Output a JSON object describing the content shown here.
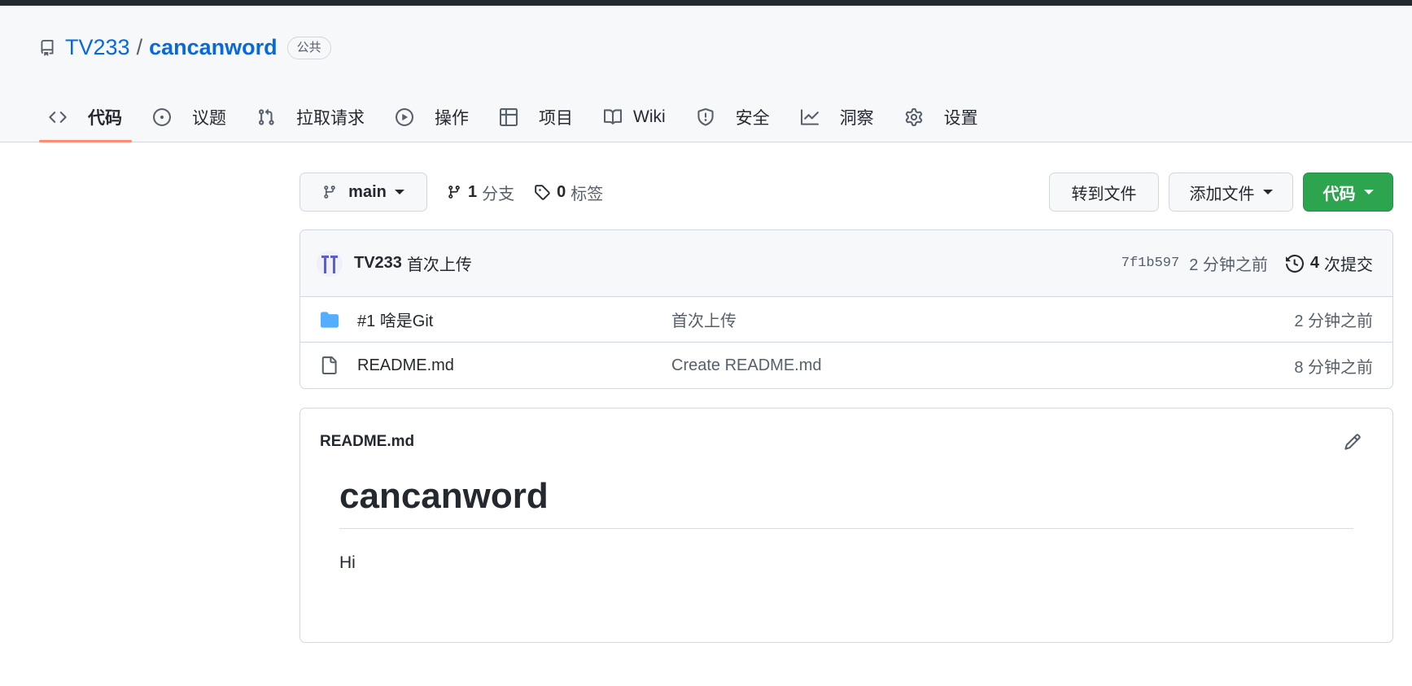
{
  "repo": {
    "owner": "TV233",
    "separator": "/",
    "name": "cancanword",
    "visibility": "公共"
  },
  "nav": {
    "tabs": [
      {
        "label": "代码",
        "icon": "code-icon",
        "active": true
      },
      {
        "label": "议题",
        "icon": "issue-icon"
      },
      {
        "label": "拉取请求",
        "icon": "pull-request-icon"
      },
      {
        "label": "操作",
        "icon": "play-icon"
      },
      {
        "label": "项目",
        "icon": "table-icon"
      },
      {
        "label": "Wiki",
        "icon": "book-icon"
      },
      {
        "label": "安全",
        "icon": "shield-icon"
      },
      {
        "label": "洞察",
        "icon": "graph-icon"
      },
      {
        "label": "设置",
        "icon": "gear-icon"
      }
    ]
  },
  "toolbar": {
    "branch": "main",
    "branches_count": "1",
    "branches_label": "分支",
    "tags_count": "0",
    "tags_label": "标签",
    "goto_file": "转到文件",
    "add_file": "添加文件",
    "code": "代码"
  },
  "commit": {
    "author": "TV233",
    "message": "首次上传",
    "sha": "7f1b597",
    "age": "2 分钟之前",
    "count": "4",
    "count_label": "次提交"
  },
  "files": [
    {
      "type": "folder",
      "name": "#1 啥是Git",
      "commit": "首次上传",
      "age": "2 分钟之前"
    },
    {
      "type": "file",
      "name": "README.md",
      "commit": "Create README.md",
      "age": "8 分钟之前"
    }
  ],
  "readme": {
    "filename": "README.md",
    "heading": "cancanword",
    "body": "Hi"
  },
  "colors": {
    "link": "#0969da",
    "primary_button": "#2da44e",
    "active_tab_underline": "#fd8c73",
    "folder_icon": "#54aeff"
  }
}
